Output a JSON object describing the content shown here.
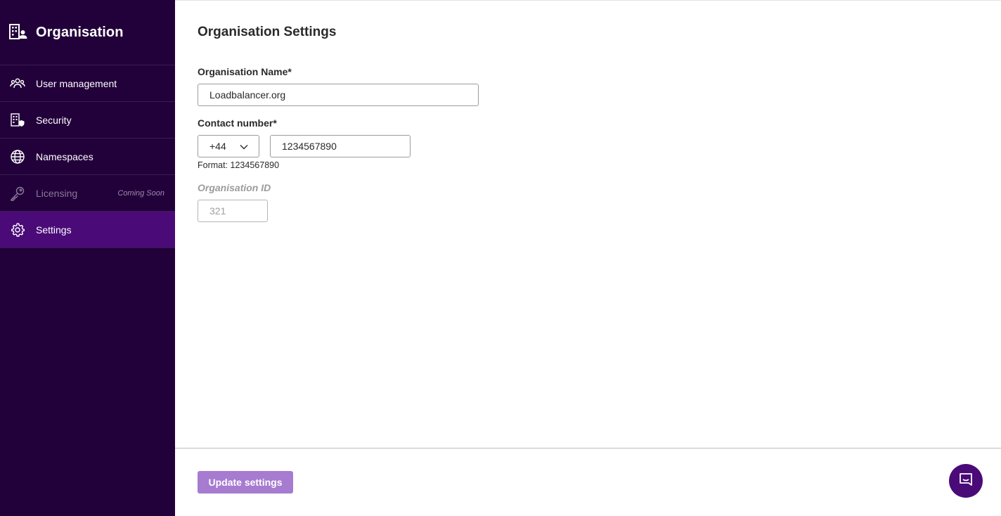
{
  "sidebar": {
    "title": "Organisation",
    "title_icon": "building-user-icon",
    "items": [
      {
        "label": "User management",
        "icon": "users-icon",
        "state": "normal"
      },
      {
        "label": "Security",
        "icon": "building-shield-icon",
        "state": "normal"
      },
      {
        "label": "Namespaces",
        "icon": "globe-icon",
        "state": "normal"
      },
      {
        "label": "Licensing",
        "icon": "key-icon",
        "state": "disabled",
        "badge": "Coming Soon"
      },
      {
        "label": "Settings",
        "icon": "gear-icon",
        "state": "active"
      }
    ]
  },
  "main": {
    "title": "Organisation Settings",
    "org_name": {
      "label": "Organisation Name*",
      "value": "Loadbalancer.org"
    },
    "contact": {
      "label": "Contact number*",
      "country_code": "+44",
      "value": "1234567890",
      "hint": "Format: 1234567890"
    },
    "org_id": {
      "label": "Organisation ID",
      "value": "321"
    },
    "update_label": "Update settings"
  },
  "chat": {
    "icon": "chat-icon"
  },
  "colors": {
    "sidebar_bg": "#22003a",
    "active_item_bg": "#4a0a78",
    "button_bg": "#a67bd0",
    "chat_bg": "#4a0a78"
  }
}
